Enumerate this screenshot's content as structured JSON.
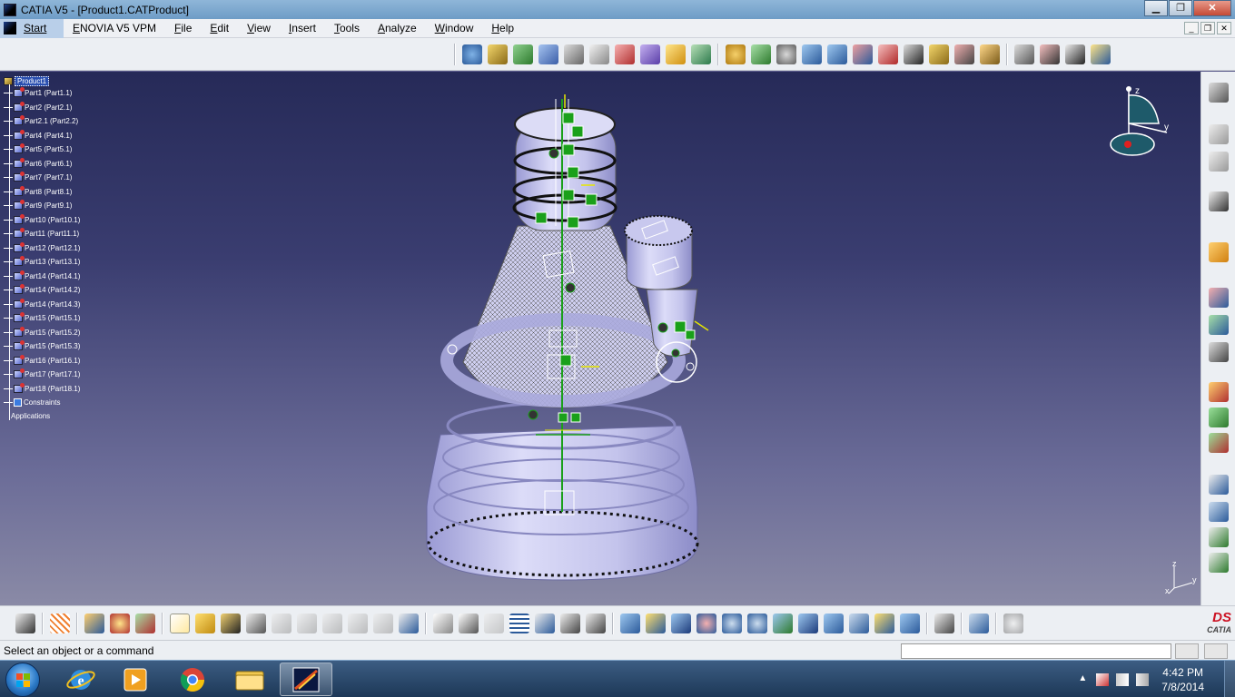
{
  "window": {
    "title": "CATIA V5 - [Product1.CATProduct]",
    "minimize_icon": "minimize-icon",
    "maximize_icon": "maximize-icon",
    "close_icon": "close-icon",
    "minimize_glyph": "▁",
    "maximize_glyph": "❐",
    "close_glyph": "✕"
  },
  "menubar": {
    "start_label": "Start",
    "items": [
      "ENOVIA V5 VPM",
      "File",
      "Edit",
      "View",
      "Insert",
      "Tools",
      "Analyze",
      "Window",
      "Help"
    ],
    "doc_minimize_glyph": "_",
    "doc_restore_glyph": "❐",
    "doc_close_glyph": "✕"
  },
  "tree": {
    "root": "Product1",
    "nodes": [
      "Part1 (Part1.1)",
      "Part2 (Part2.1)",
      "Part2.1 (Part2.2)",
      "Part4 (Part4.1)",
      "Part5 (Part5.1)",
      "Part6 (Part6.1)",
      "Part7 (Part7.1)",
      "Part8 (Part8.1)",
      "Part9 (Part9.1)",
      "Part10 (Part10.1)",
      "Part11 (Part11.1)",
      "Part12 (Part12.1)",
      "Part13 (Part13.1)",
      "Part14 (Part14.1)",
      "Part14 (Part14.2)",
      "Part14 (Part14.3)",
      "Part15 (Part15.1)",
      "Part15 (Part15.2)",
      "Part15 (Part15.3)",
      "Part16 (Part16.1)",
      "Part17 (Part17.1)",
      "Part18 (Part18.1)"
    ],
    "constraints": "Constraints",
    "applications": "Applications"
  },
  "compass": {
    "z_label": "z",
    "y_label": "y"
  },
  "mini_axis": {
    "z_label": "z",
    "y_label": "y",
    "x_label": "x"
  },
  "statusbar": {
    "message": "Select an object or a command",
    "command_value": ""
  },
  "catia_logo": {
    "ds": "DS",
    "name": "CATIA"
  },
  "taskbar": {
    "time": "4:42 PM",
    "date": "7/8/2014",
    "apps": [
      "internet-explorer-icon",
      "media-player-icon",
      "chrome-icon",
      "file-explorer-icon",
      "catia-icon"
    ]
  },
  "colors": {
    "viewport_top": "#262a58",
    "viewport_bottom": "#8a8aa6",
    "model_body": "#c9c9ee",
    "constraint_green": "#1aa01a",
    "constraint_yellow": "#e6e600"
  }
}
